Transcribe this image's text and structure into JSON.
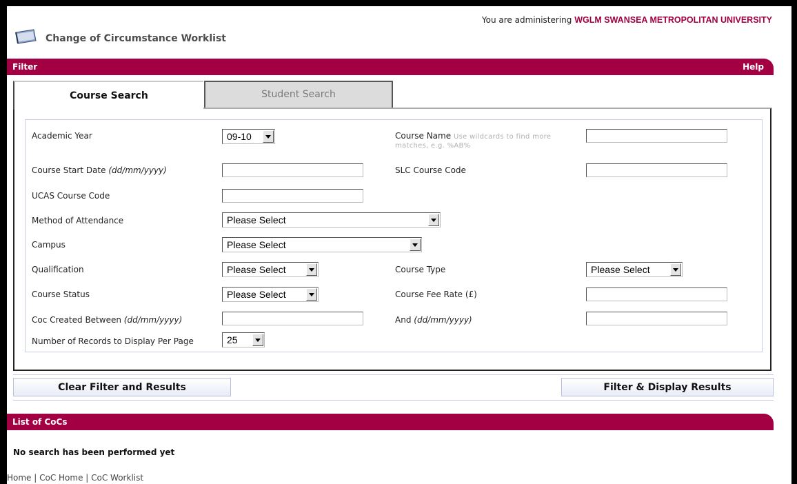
{
  "header": {
    "admin_prefix": "You are administering",
    "admin_org": "WGLM SWANSEA METROPOLITAN UNIVERSITY",
    "page_title": "Change of Circumstance Worklist"
  },
  "filter_bar": {
    "title": "Filter",
    "help": "Help"
  },
  "tabs": {
    "course_search": "Course Search",
    "student_search": "Student Search"
  },
  "form": {
    "academic_year": {
      "label": "Academic Year",
      "value": "09-10"
    },
    "course_name": {
      "label": "Course Name",
      "hint_line1": "Use wildcards to find more",
      "hint_line2": "matches, e.g. %AB%",
      "value": ""
    },
    "course_start_date": {
      "label": "Course Start Date",
      "format": "(dd/mm/yyyy)",
      "value": ""
    },
    "slc_course_code": {
      "label": "SLC Course Code",
      "value": ""
    },
    "ucas_course_code": {
      "label": "UCAS Course Code",
      "value": ""
    },
    "method_of_attendance": {
      "label": "Method of Attendance",
      "value": "Please Select"
    },
    "campus": {
      "label": "Campus",
      "value": "Please Select"
    },
    "qualification": {
      "label": "Qualification",
      "value": "Please Select"
    },
    "course_type": {
      "label": "Course Type",
      "value": "Please Select"
    },
    "course_status": {
      "label": "Course Status",
      "value": "Please Select"
    },
    "course_fee_rate": {
      "label": "Course Fee Rate (£)",
      "value": ""
    },
    "coc_created_between": {
      "label": "Coc Created Between",
      "format": "(dd/mm/yyyy)",
      "value": ""
    },
    "and_date": {
      "label": "And",
      "format": "(dd/mm/yyyy)",
      "value": ""
    },
    "records_per_page": {
      "label": "Number of Records to Display Per Page",
      "value": "25"
    }
  },
  "buttons": {
    "clear": "Clear Filter and Results",
    "filter": "Filter & Display Results"
  },
  "list_bar": {
    "title": "List of CoCs"
  },
  "results": {
    "message": "No search has been performed yet"
  },
  "footer": {
    "home": "Home",
    "coc_home": "CoC Home",
    "coc_worklist": "CoC Worklist",
    "separator": " | "
  },
  "colors": {
    "brand": "#a30043",
    "panel_border": "#c8cde6",
    "tab_inactive": "#dcdcdc"
  }
}
